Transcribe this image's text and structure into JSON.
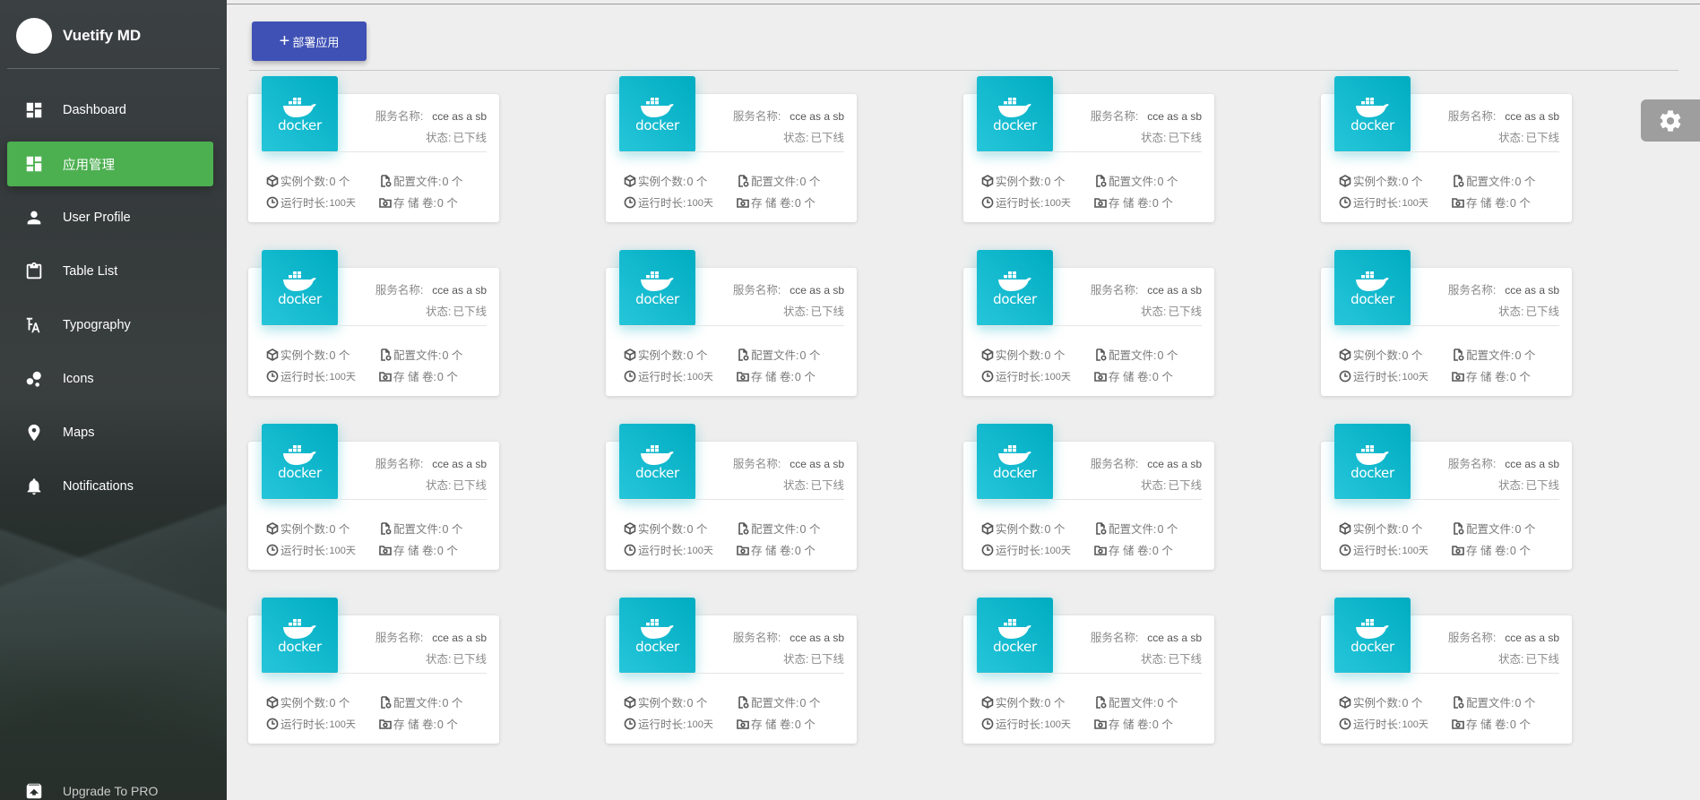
{
  "brand": {
    "name": "Vuetify MD"
  },
  "sidebar": {
    "items": [
      {
        "label": "Dashboard",
        "icon": "dashboard-icon"
      },
      {
        "label": "应用管理",
        "icon": "dashboard-icon",
        "active": true
      },
      {
        "label": "User Profile",
        "icon": "person-icon"
      },
      {
        "label": "Table List",
        "icon": "clipboard-icon"
      },
      {
        "label": "Typography",
        "icon": "typography-icon"
      },
      {
        "label": "Icons",
        "icon": "bubbles-icon"
      },
      {
        "label": "Maps",
        "icon": "map-pin-icon"
      },
      {
        "label": "Notifications",
        "icon": "bell-icon"
      }
    ],
    "pro": {
      "label": "Upgrade To PRO",
      "icon": "unarchive-icon"
    }
  },
  "toolbar": {
    "deploy_label": "部署应用"
  },
  "labels": {
    "service_name": "服务名称:",
    "status": "状态:",
    "instances": "实例个数:",
    "config_files": "配置文件:",
    "uptime": "运行时长:",
    "volumes": "存 储 卷:"
  },
  "apps": [
    {
      "logo_text": "docker",
      "service_name": "cce as a sb",
      "status": "已下线",
      "instances": "0 个",
      "config_files": "0 个",
      "uptime": "100天",
      "volumes": "0 个"
    },
    {
      "logo_text": "docker",
      "service_name": "cce as a sb",
      "status": "已下线",
      "instances": "0 个",
      "config_files": "0 个",
      "uptime": "100天",
      "volumes": "0 个"
    },
    {
      "logo_text": "docker",
      "service_name": "cce as a sb",
      "status": "已下线",
      "instances": "0 个",
      "config_files": "0 个",
      "uptime": "100天",
      "volumes": "0 个"
    },
    {
      "logo_text": "docker",
      "service_name": "cce as a sb",
      "status": "已下线",
      "instances": "0 个",
      "config_files": "0 个",
      "uptime": "100天",
      "volumes": "0 个"
    },
    {
      "logo_text": "docker",
      "service_name": "cce as a sb",
      "status": "已下线",
      "instances": "0 个",
      "config_files": "0 个",
      "uptime": "100天",
      "volumes": "0 个"
    },
    {
      "logo_text": "docker",
      "service_name": "cce as a sb",
      "status": "已下线",
      "instances": "0 个",
      "config_files": "0 个",
      "uptime": "100天",
      "volumes": "0 个"
    },
    {
      "logo_text": "docker",
      "service_name": "cce as a sb",
      "status": "已下线",
      "instances": "0 个",
      "config_files": "0 个",
      "uptime": "100天",
      "volumes": "0 个"
    },
    {
      "logo_text": "docker",
      "service_name": "cce as a sb",
      "status": "已下线",
      "instances": "0 个",
      "config_files": "0 个",
      "uptime": "100天",
      "volumes": "0 个"
    },
    {
      "logo_text": "docker",
      "service_name": "cce as a sb",
      "status": "已下线",
      "instances": "0 个",
      "config_files": "0 个",
      "uptime": "100天",
      "volumes": "0 个"
    },
    {
      "logo_text": "docker",
      "service_name": "cce as a sb",
      "status": "已下线",
      "instances": "0 个",
      "config_files": "0 个",
      "uptime": "100天",
      "volumes": "0 个"
    },
    {
      "logo_text": "docker",
      "service_name": "cce as a sb",
      "status": "已下线",
      "instances": "0 个",
      "config_files": "0 个",
      "uptime": "100天",
      "volumes": "0 个"
    },
    {
      "logo_text": "docker",
      "service_name": "cce as a sb",
      "status": "已下线",
      "instances": "0 个",
      "config_files": "0 个",
      "uptime": "100天",
      "volumes": "0 个"
    },
    {
      "logo_text": "docker",
      "service_name": "cce as a sb",
      "status": "已下线",
      "instances": "0 个",
      "config_files": "0 个",
      "uptime": "100天",
      "volumes": "0 个"
    },
    {
      "logo_text": "docker",
      "service_name": "cce as a sb",
      "status": "已下线",
      "instances": "0 个",
      "config_files": "0 个",
      "uptime": "100天",
      "volumes": "0 个"
    },
    {
      "logo_text": "docker",
      "service_name": "cce as a sb",
      "status": "已下线",
      "instances": "0 个",
      "config_files": "0 个",
      "uptime": "100天",
      "volumes": "0 个"
    },
    {
      "logo_text": "docker",
      "service_name": "cce as a sb",
      "status": "已下线",
      "instances": "0 个",
      "config_files": "0 个",
      "uptime": "100天",
      "volumes": "0 个"
    }
  ],
  "colors": {
    "sidebar_active": "#4caf50",
    "deploy_button": "#3f51b5",
    "card_thumb": "#00bcd4",
    "settings_tab": "#9e9e9e"
  }
}
